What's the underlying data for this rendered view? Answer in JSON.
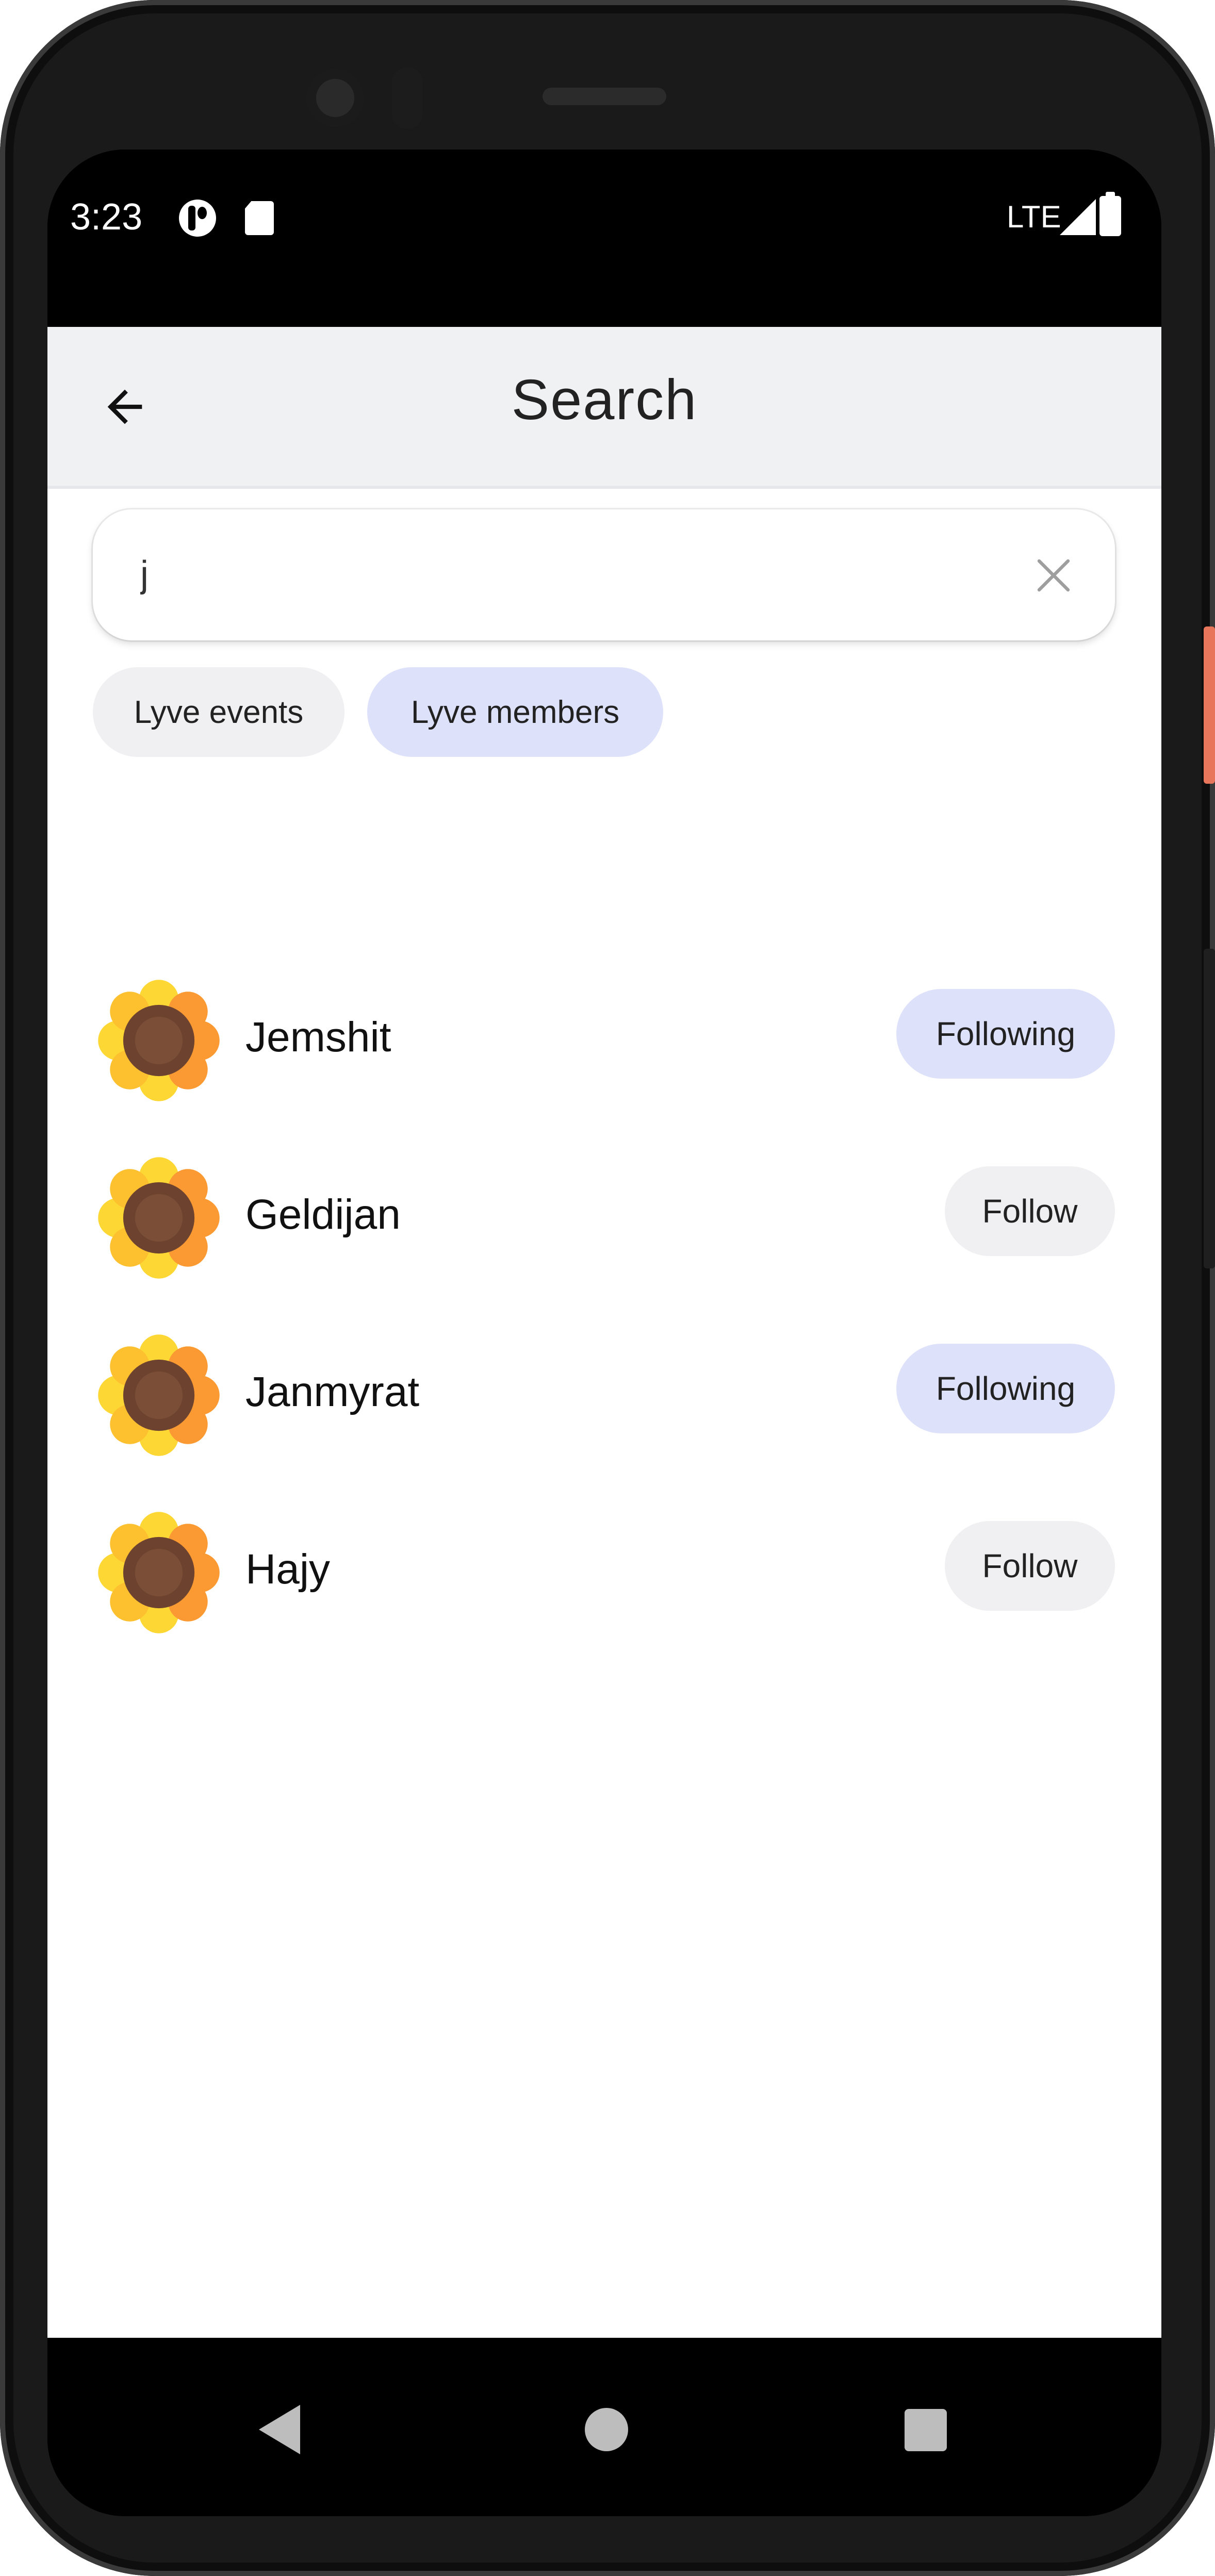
{
  "status_bar": {
    "time": "3:23",
    "network": "LTE",
    "icons": [
      "app-notification-icon",
      "sd-card-icon",
      "signal-icon",
      "battery-icon"
    ]
  },
  "header": {
    "title": "Search",
    "back_icon": "arrow-left-icon"
  },
  "search": {
    "value": "j",
    "clear_icon": "close-icon"
  },
  "filters": [
    {
      "label": "Lyve events",
      "selected": false
    },
    {
      "label": "Lyve members",
      "selected": true
    }
  ],
  "members": [
    {
      "name": "Jemshit",
      "button": "Following",
      "following": true,
      "avatar": "sunflower-icon"
    },
    {
      "name": "Geldijan",
      "button": "Follow",
      "following": false,
      "avatar": "sunflower-icon"
    },
    {
      "name": "Janmyrat",
      "button": "Following",
      "following": true,
      "avatar": "sunflower-icon"
    },
    {
      "name": "Hajy",
      "button": "Follow",
      "following": false,
      "avatar": "sunflower-icon"
    }
  ],
  "colors": {
    "selected_chip": "#dee1fa",
    "unselected_chip": "#f0f0f2",
    "appbar": "#f0f1f3",
    "petal_yellow": "#fdd835",
    "petal_orange": "#fb9a32",
    "seed_brown": "#6d4330"
  },
  "nav_bar": {
    "icons": [
      "nav-back-icon",
      "nav-home-icon",
      "nav-recents-icon"
    ]
  }
}
